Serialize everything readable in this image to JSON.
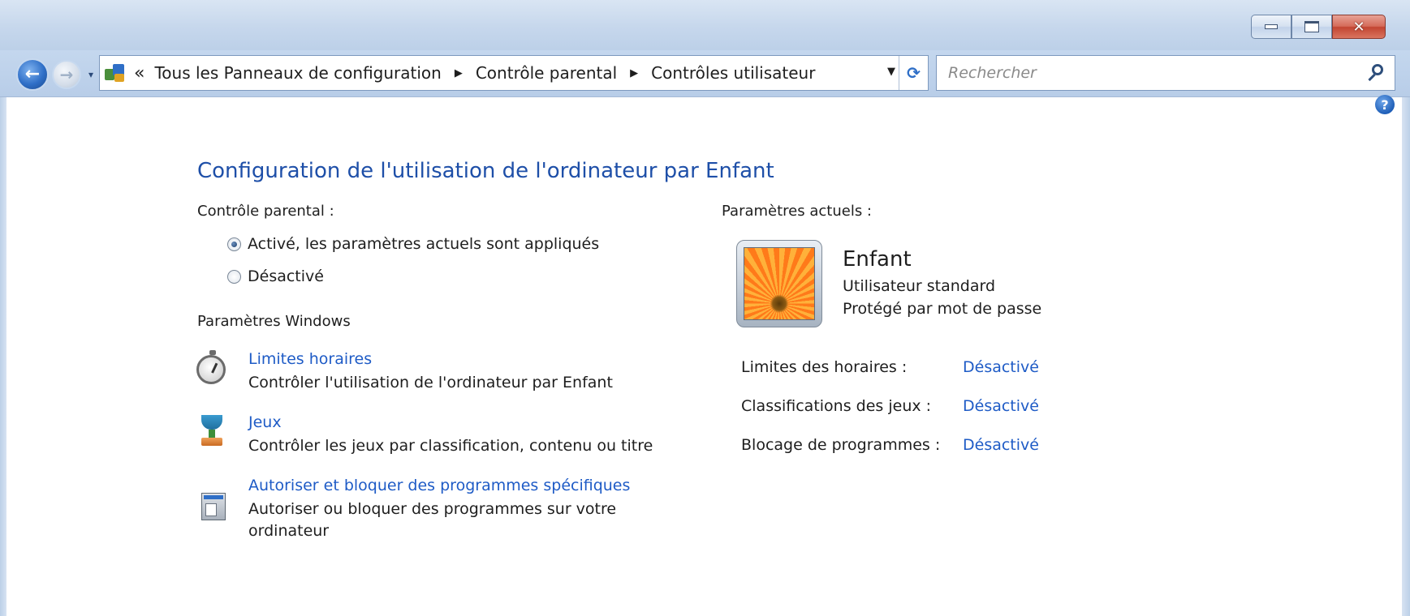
{
  "window": {
    "caption": {
      "minimize_icon": "minimize-icon",
      "maximize_icon": "maximize-icon",
      "close_glyph": "✕"
    }
  },
  "navigation": {
    "back_icon": "back-arrow-icon",
    "forward_icon": "forward-arrow-icon",
    "back_glyph": "←",
    "forward_glyph": "→",
    "history_glyph": "▾"
  },
  "breadcrumb": {
    "overflow": "«",
    "items": [
      "Tous les Panneaux de configuration",
      "Contrôle parental",
      "Contrôles utilisateur"
    ],
    "separator": "▶",
    "dropdown_glyph": "▼",
    "refresh_glyph": "⟳"
  },
  "search": {
    "placeholder": "Rechercher"
  },
  "help": {
    "glyph": "?"
  },
  "page": {
    "title": "Configuration de l'utilisation de l'ordinateur par Enfant",
    "parental_control_label": "Contrôle parental :",
    "options": [
      {
        "label": "Activé, les paramètres actuels sont appliqués",
        "checked": true
      },
      {
        "label": "Désactivé",
        "checked": false
      }
    ],
    "windows_settings_label": "Paramètres Windows",
    "settings": [
      {
        "link": "Limites horaires",
        "description": "Contrôler l'utilisation de l'ordinateur par Enfant",
        "icon": "stopwatch-icon"
      },
      {
        "link": "Jeux",
        "description": "Contrôler les jeux par classification, contenu ou titre",
        "icon": "trophy-icon"
      },
      {
        "link": "Autoriser et bloquer des programmes spécifiques",
        "description": "Autoriser ou bloquer des programmes sur votre ordinateur",
        "icon": "programs-icon"
      }
    ]
  },
  "current_settings": {
    "label": "Paramètres actuels :",
    "user": {
      "name": "Enfant",
      "type": "Utilisateur standard",
      "protection": "Protégé par mot de passe",
      "avatar_icon": "flower-avatar-icon"
    },
    "summary": [
      {
        "label": "Limites des horaires :",
        "value": "Désactivé"
      },
      {
        "label": "Classifications des jeux :",
        "value": "Désactivé"
      },
      {
        "label": "Blocage de programmes :",
        "value": "Désactivé"
      }
    ]
  },
  "colors": {
    "link": "#1e5bc6",
    "title": "#1e4fa8",
    "chrome": "#c6d7ec"
  }
}
